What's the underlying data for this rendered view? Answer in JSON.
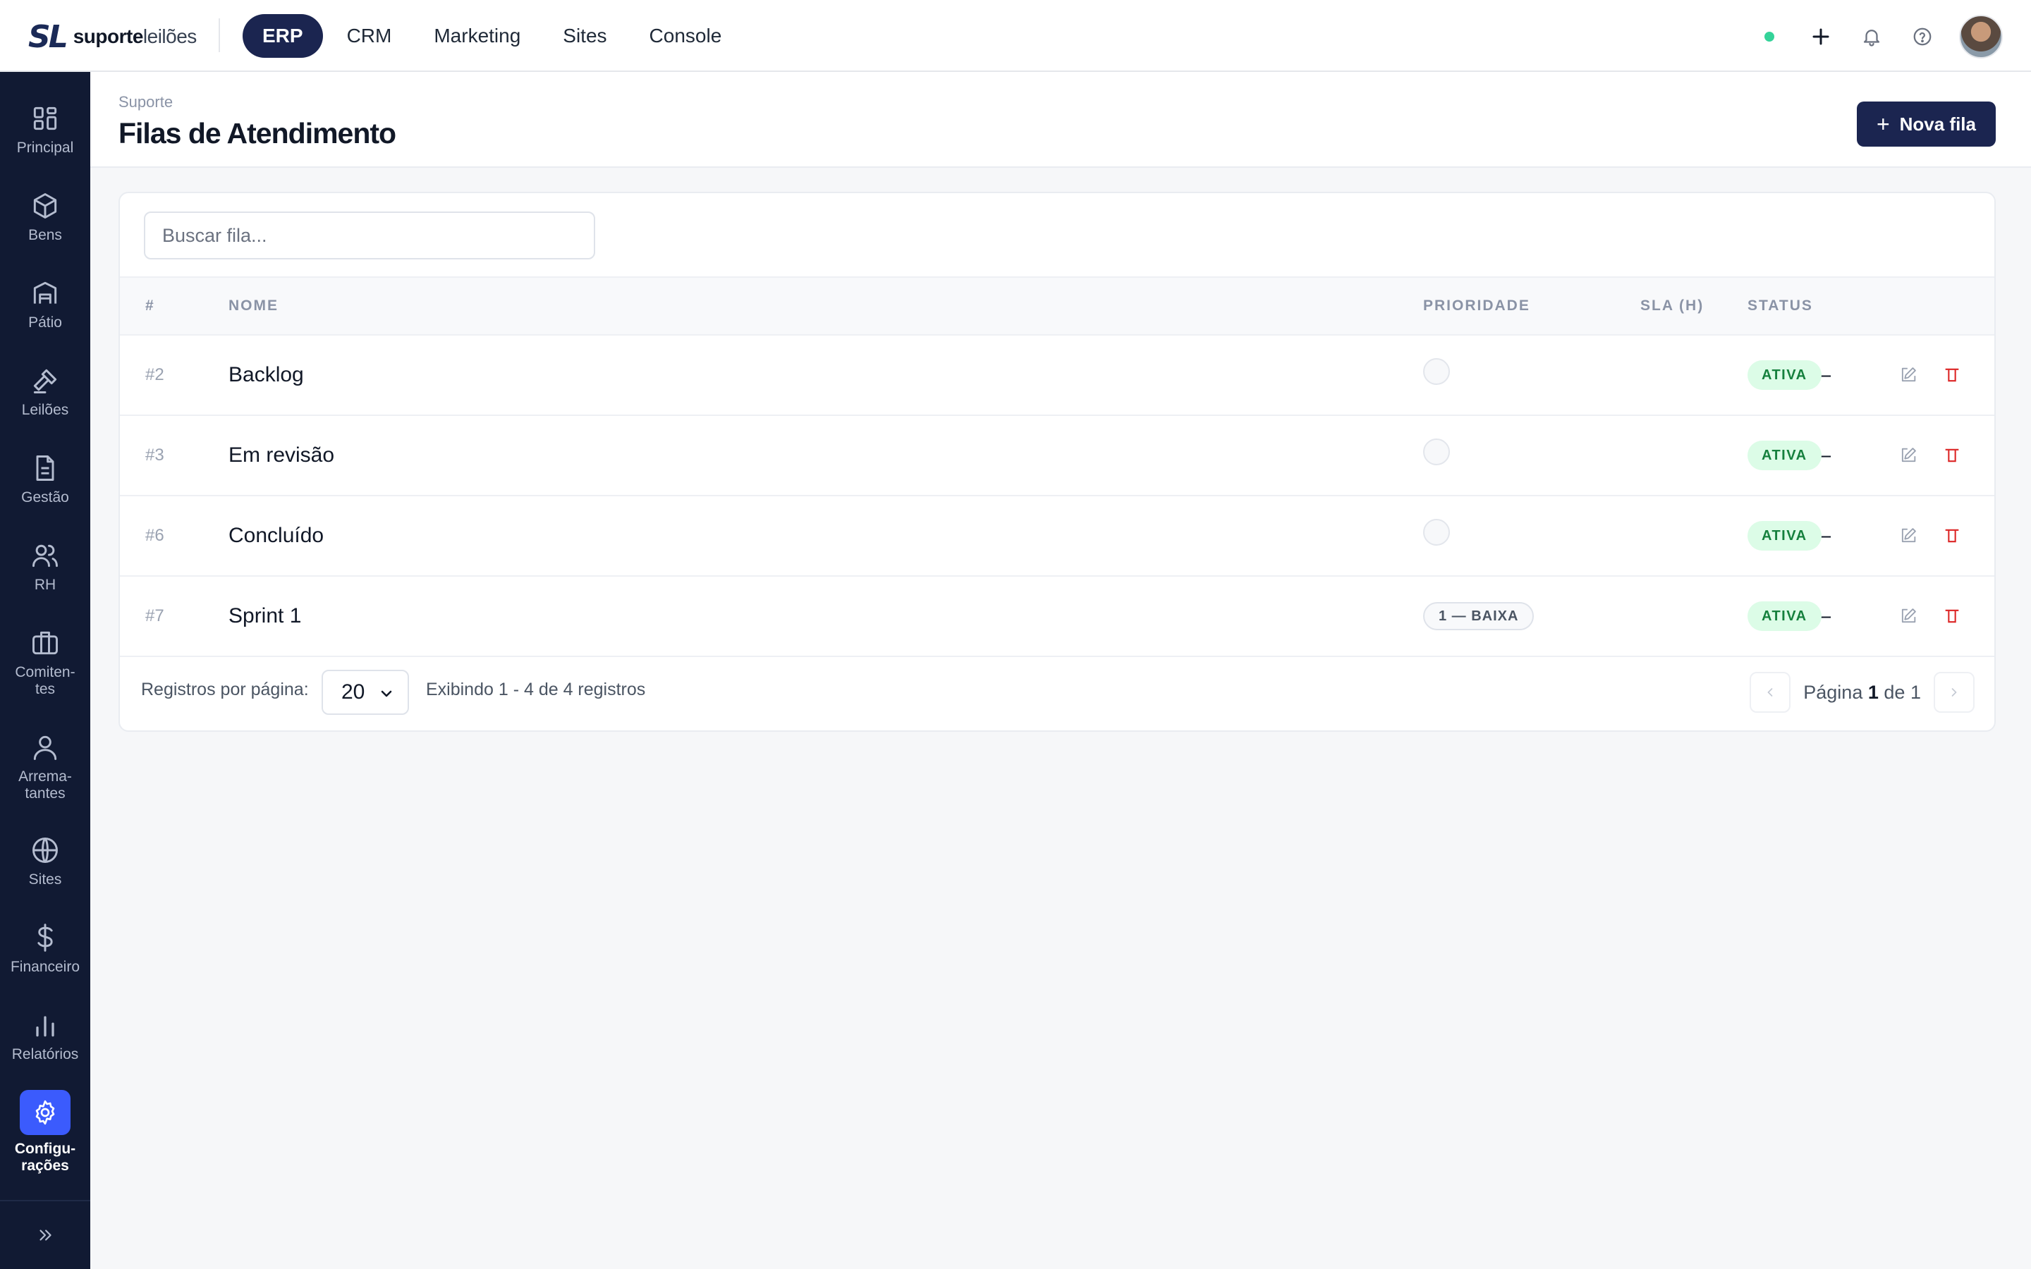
{
  "brand": {
    "mark": "SL",
    "name_bold": "suporte",
    "name_light": "leilões"
  },
  "topnav": [
    {
      "label": "ERP",
      "active": true
    },
    {
      "label": "CRM"
    },
    {
      "label": "Marketing"
    },
    {
      "label": "Sites"
    },
    {
      "label": "Console"
    }
  ],
  "sidebar": {
    "items": [
      {
        "label": "Principal",
        "icon": "grid-icon"
      },
      {
        "label": "Bens",
        "icon": "box-icon"
      },
      {
        "label": "Pátio",
        "icon": "warehouse-icon"
      },
      {
        "label": "Leilões",
        "icon": "gavel-icon"
      },
      {
        "label": "Gestão",
        "icon": "document-icon"
      },
      {
        "label": "RH",
        "icon": "users-icon"
      },
      {
        "label_1": "Comiten-",
        "label_2": "tes",
        "icon": "briefcase-icon"
      },
      {
        "label_1": "Arrema-",
        "label_2": "tantes",
        "icon": "user-icon"
      },
      {
        "label": "Sites",
        "icon": "globe-icon"
      },
      {
        "label": "Financeiro",
        "icon": "dollar-icon"
      },
      {
        "label": "Relatórios",
        "icon": "bar-chart-icon"
      },
      {
        "label_1": "Configu-",
        "label_2": "rações",
        "icon": "gear-icon",
        "active": true
      }
    ]
  },
  "header": {
    "breadcrumb": "Suporte",
    "title": "Filas de Atendimento",
    "new_button": "Nova fila"
  },
  "search": {
    "placeholder": "Buscar fila..."
  },
  "table": {
    "columns": {
      "id": "#",
      "name": "NOME",
      "priority": "PRIORIDADE",
      "sla": "SLA (H)",
      "status": "STATUS"
    },
    "rows": [
      {
        "id": "#2",
        "name": "Backlog",
        "priority": "",
        "sla": "–",
        "status": "ATIVA"
      },
      {
        "id": "#3",
        "name": "Em revisão",
        "priority": "",
        "sla": "–",
        "status": "ATIVA"
      },
      {
        "id": "#6",
        "name": "Concluído",
        "priority": "",
        "sla": "–",
        "status": "ATIVA"
      },
      {
        "id": "#7",
        "name": "Sprint 1",
        "priority": "1 — BAIXA",
        "sla": "–",
        "status": "ATIVA"
      }
    ]
  },
  "footer": {
    "per_page_label": "Registros por página:",
    "per_page_value": "20",
    "showing": "Exibindo 1 - 4 de 4 registros",
    "page_prefix": "Página",
    "page_current": "1",
    "page_sep": "de",
    "page_total": "1"
  },
  "colors": {
    "primary": "#1b2550",
    "sidebar": "#111a33",
    "accent": "#3b5bfd",
    "status_bg": "#dcfce7",
    "status_fg": "#15803d",
    "danger": "#dc2626"
  }
}
